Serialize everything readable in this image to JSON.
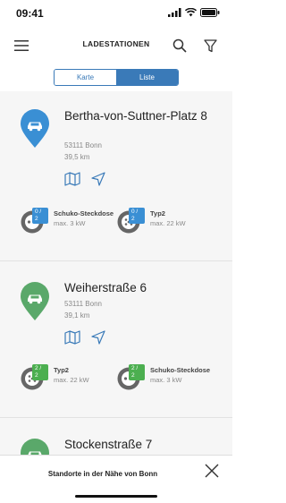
{
  "status": {
    "time": "09:41"
  },
  "header": {
    "title": "LADESTATIONEN"
  },
  "tabs": [
    {
      "label": "Karte"
    },
    {
      "label": "Liste"
    }
  ],
  "stations": [
    {
      "name": "Bertha-von-Suttner-Platz 8",
      "city": "53111 Bonn",
      "distance": "39,5 km",
      "pin_color": "#3a8fd4",
      "connectors": [
        {
          "type": "Schuko-Steckdose",
          "power": "max. 3 kW",
          "availability": "0 / 2",
          "badge_color": "#3a8fd4"
        },
        {
          "type": "Typ2",
          "power": "max. 22 kW",
          "availability": "0 / 2",
          "badge_color": "#3a8fd4"
        }
      ]
    },
    {
      "name": "Weiherstraße 6",
      "city": "53111 Bonn",
      "distance": "39,1 km",
      "pin_color": "#5aa86a",
      "connectors": [
        {
          "type": "Typ2",
          "power": "max. 22 kW",
          "availability": "2 / 2",
          "badge_color": "#4caf50"
        },
        {
          "type": "Schuko-Steckdose",
          "power": "max. 3 kW",
          "availability": "2 / 2",
          "badge_color": "#4caf50"
        }
      ]
    },
    {
      "name": "Stockenstraße 7",
      "pin_color": "#5aa86a"
    }
  ],
  "bottom": {
    "text": "Standorte in der Nähe von Bonn"
  },
  "icons": [
    "menu-icon",
    "search-icon",
    "filter-icon",
    "map-icon",
    "navigate-icon",
    "close-icon",
    "car-icon",
    "plug-icon"
  ]
}
